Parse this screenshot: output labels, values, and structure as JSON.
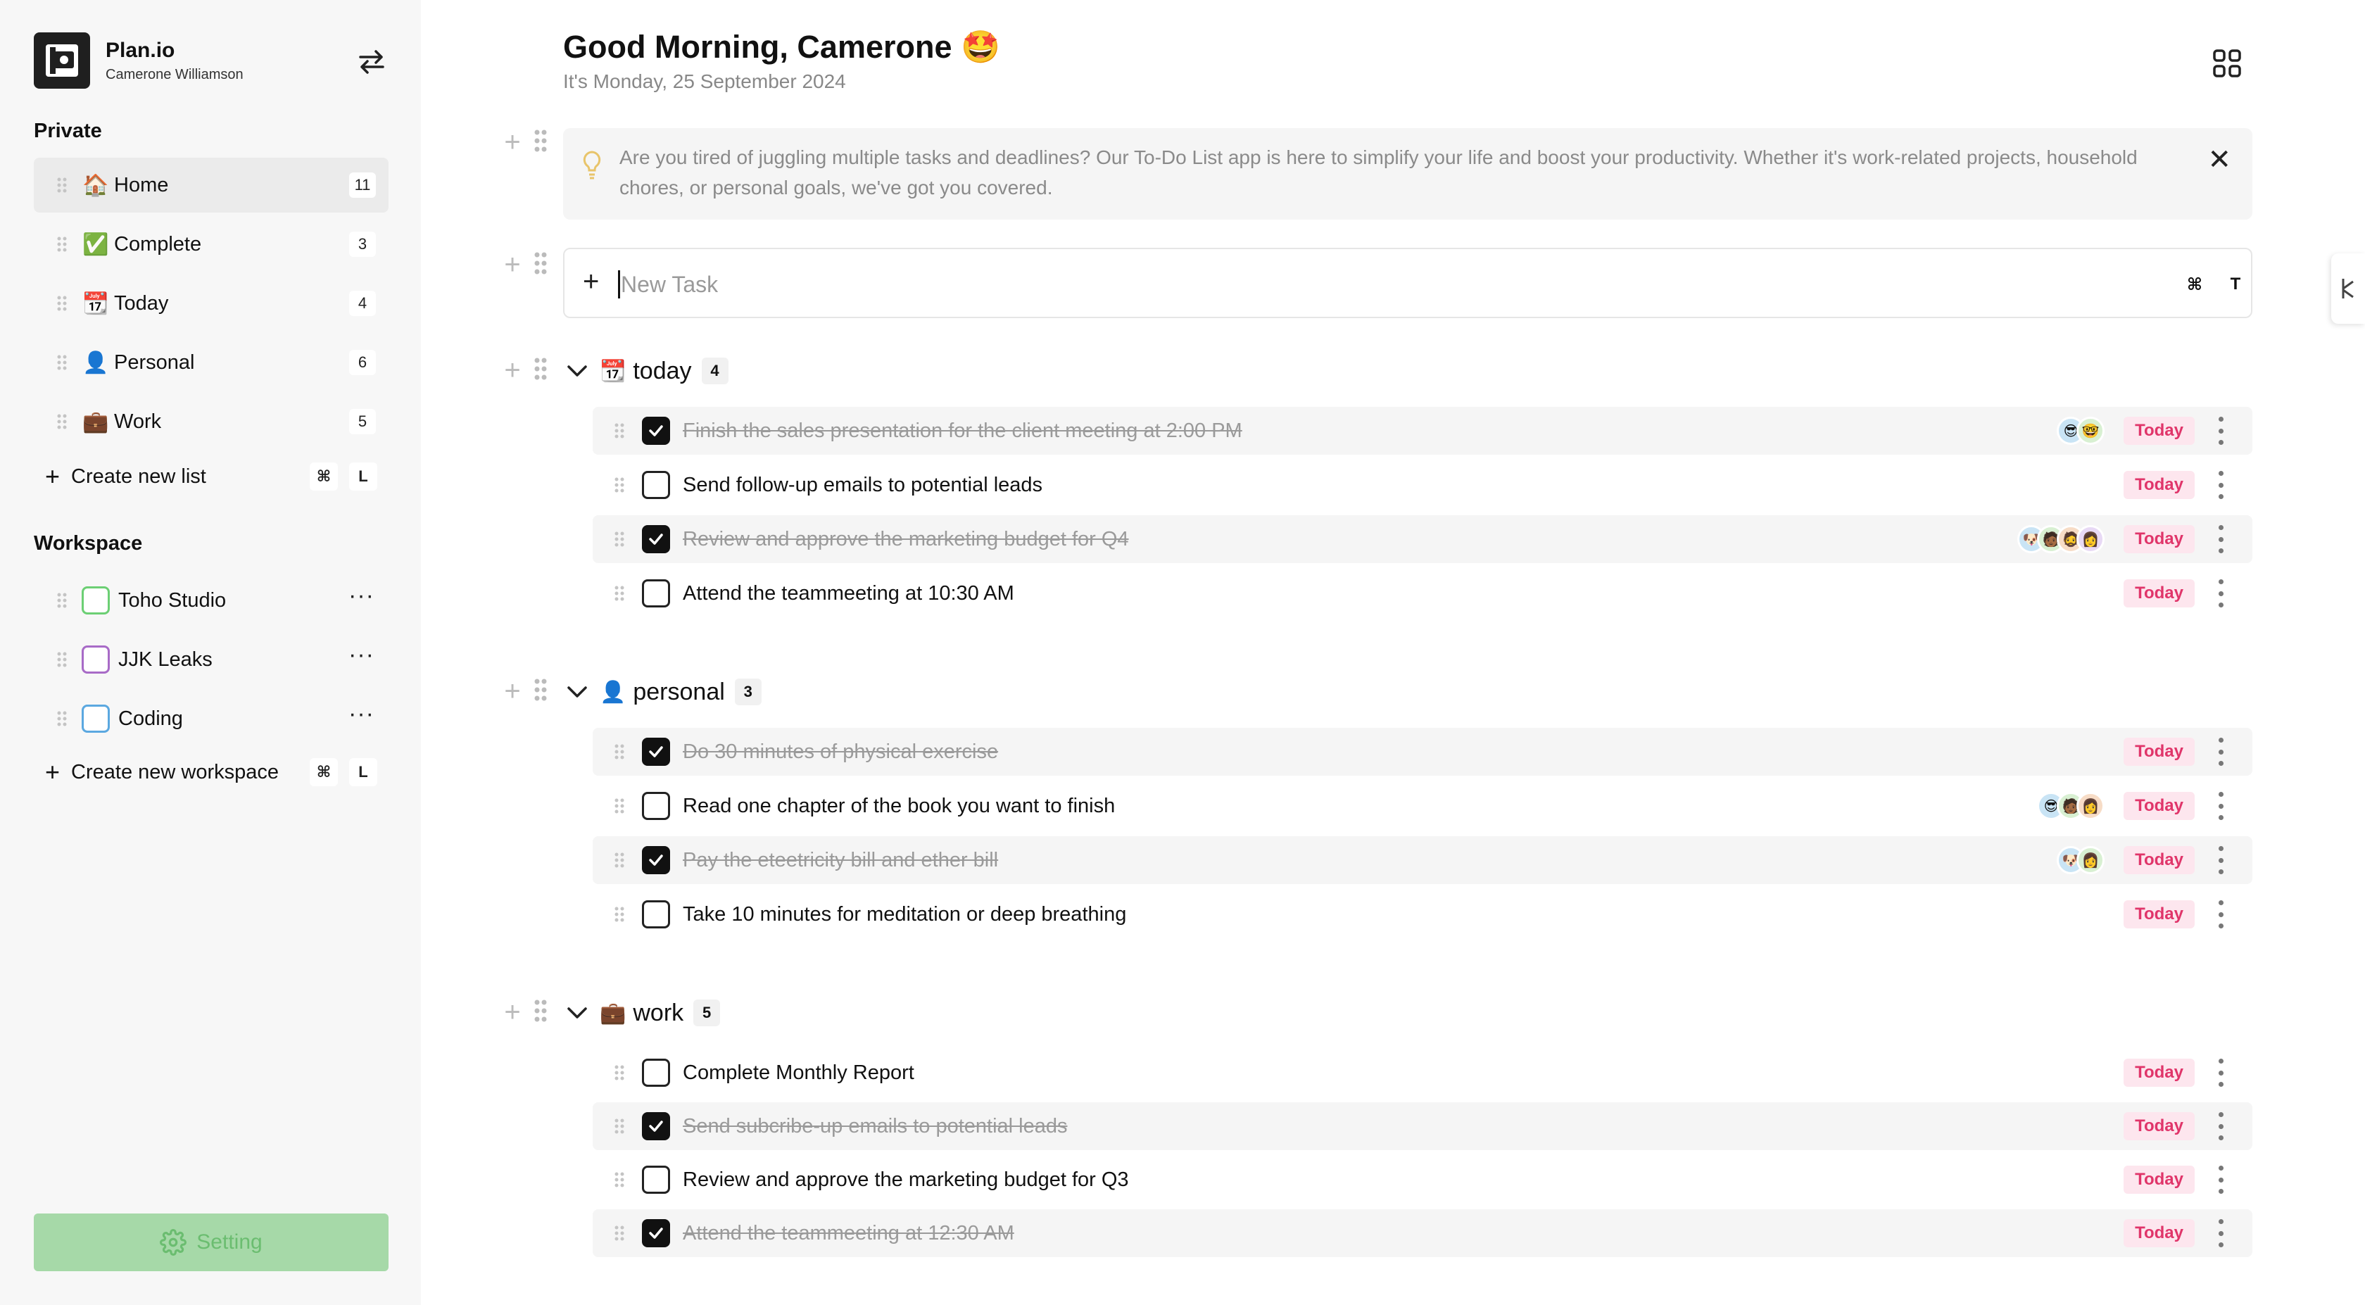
{
  "brand": {
    "name": "Plan.io",
    "user": "Camerone Williamson"
  },
  "sidebar": {
    "private_title": "Private",
    "private_items": [
      {
        "emoji": "🏠",
        "label": "Home",
        "count": "11"
      },
      {
        "emoji": "✅",
        "label": "Complete",
        "count": "3"
      },
      {
        "emoji": "📆",
        "label": "Today",
        "count": "4"
      },
      {
        "emoji": "👤",
        "label": "Personal",
        "count": "6"
      },
      {
        "emoji": "💼",
        "label": "Work",
        "count": "5"
      }
    ],
    "create_list": {
      "label": "Create new list",
      "key1": "⌘",
      "key2": "L"
    },
    "workspace_title": "Workspace",
    "workspaces": [
      {
        "label": "Toho Studio",
        "color": "#6ccf74",
        "more": "···"
      },
      {
        "label": "JJK Leaks",
        "color": "#a86bc7",
        "more": "···"
      },
      {
        "label": "Coding",
        "color": "#5ba8e0",
        "more": "···"
      }
    ],
    "create_workspace": {
      "label": "Create new workspace",
      "key1": "⌘",
      "key2": "L"
    },
    "setting_label": "Setting"
  },
  "header": {
    "greeting": "Good Morning, Camerone 🤩",
    "date": "It's Monday, 25 September 2024"
  },
  "banner": {
    "text": "Are you tired of juggling multiple tasks and deadlines? Our To-Do List app is here to simplify your life and boost your productivity. Whether it's work-related projects, household chores, or personal goals, we've got you covered.",
    "close": "✕"
  },
  "new_task": {
    "plus": "+",
    "placeholder": "New Task",
    "key1": "⌘",
    "key2": "T"
  },
  "groups": [
    {
      "emoji": "📆",
      "name": "today",
      "count": "4",
      "tasks": [
        {
          "text": "Finish the sales presentation for the client meeting at 2:00 PM",
          "done": true,
          "avatars": [
            "😎",
            "🤓"
          ],
          "due": "Today"
        },
        {
          "text": "Send follow-up emails to potential leads",
          "done": false,
          "avatars": [],
          "due": "Today"
        },
        {
          "text": "Review and approve the marketing budget for Q4",
          "done": true,
          "avatars": [
            "🐶",
            "🧑🏾",
            "🧔",
            "👩"
          ],
          "due": "Today"
        },
        {
          "text": "Attend the teammeeting at 10:30 AM",
          "done": false,
          "avatars": [],
          "due": "Today"
        }
      ]
    },
    {
      "emoji": "👤",
      "name": "personal",
      "count": "3",
      "tasks": [
        {
          "text": "Do 30 minutes of physical exercise",
          "done": true,
          "avatars": [],
          "due": "Today"
        },
        {
          "text": "Read one chapter of the book you want to finish",
          "done": false,
          "avatars": [
            "😎",
            "🧑🏾",
            "👩"
          ],
          "due": "Today"
        },
        {
          "text": "Pay the eteetricity bill and ether bill",
          "done": true,
          "avatars": [
            "🐶",
            "👩"
          ],
          "due": "Today"
        },
        {
          "text": "Take 10 minutes for meditation or deep breathing",
          "done": false,
          "avatars": [],
          "due": "Today"
        }
      ]
    },
    {
      "emoji": "💼",
      "name": "work",
      "count": "5",
      "tasks": [
        {
          "text": "Complete Monthly Report",
          "done": false,
          "avatars": [],
          "due": "Today"
        },
        {
          "text": "Send subcribe-up emails to potential leads",
          "done": true,
          "avatars": [],
          "due": "Today"
        },
        {
          "text": "Review and approve the marketing budget for Q3",
          "done": false,
          "avatars": [],
          "due": "Today"
        },
        {
          "text": "Attend the teammeeting at 12:30 AM",
          "done": true,
          "avatars": [],
          "due": "Today"
        }
      ]
    }
  ],
  "colors": {
    "setting_bg": "#a6d9a8",
    "due_bg": "#fde6ee",
    "due_text": "#e0356a"
  }
}
